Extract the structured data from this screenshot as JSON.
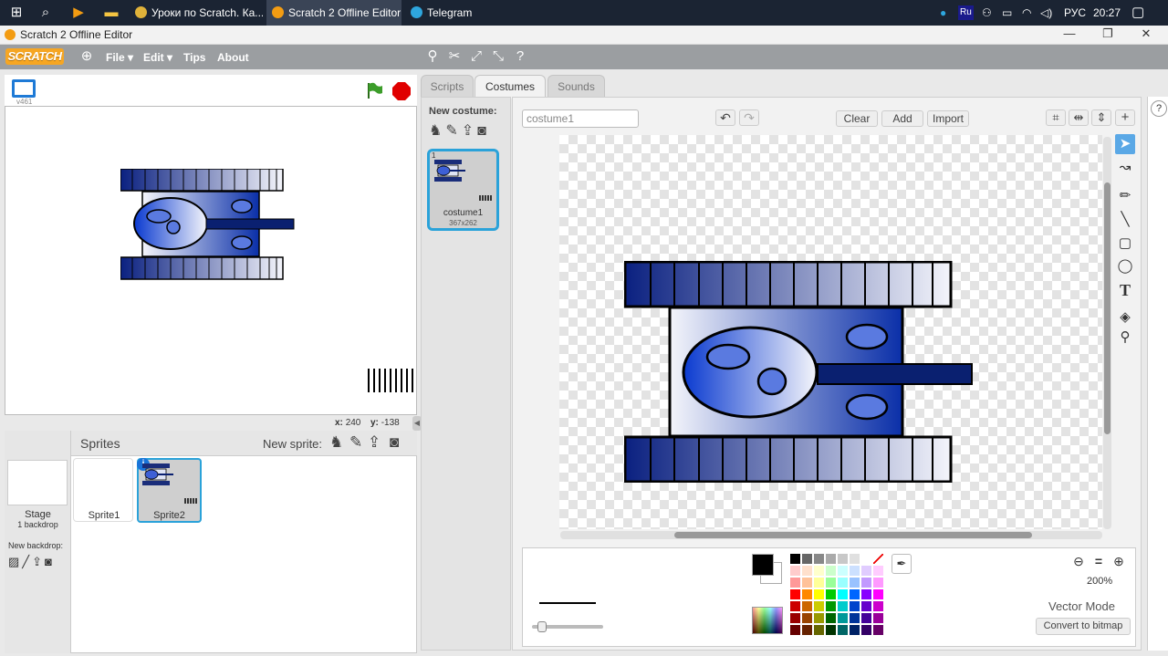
{
  "taskbar": {
    "apps": [
      {
        "label": "Уроки по Scratch. Ка..."
      },
      {
        "label": "Scratch 2 Offline Editor"
      },
      {
        "label": "Telegram"
      }
    ],
    "lang": "РУС",
    "time": "20:27"
  },
  "window": {
    "title": "Scratch 2 Offline Editor"
  },
  "menubar": {
    "logo": "SCRATCH",
    "items": [
      "File ▾",
      "Edit ▾",
      "Tips",
      "About"
    ]
  },
  "stage": {
    "version": "v461",
    "x_label": "x:",
    "x_value": "240",
    "y_label": "y:",
    "y_value": "-138"
  },
  "sprites": {
    "title": "Sprites",
    "new_sprite": "New sprite:",
    "stage_label": "Stage",
    "stage_sub": "1 backdrop",
    "new_backdrop": "New backdrop:",
    "items": [
      {
        "name": "Sprite1"
      },
      {
        "name": "Sprite2"
      }
    ]
  },
  "tabs": [
    "Scripts",
    "Costumes",
    "Sounds"
  ],
  "costumes": {
    "new_costume": "New costume:",
    "list": [
      {
        "index": "1",
        "name": "costume1",
        "size": "367x262"
      }
    ]
  },
  "editor": {
    "name_value": "costume1",
    "clear": "Clear",
    "add": "Add",
    "import": "Import",
    "zoom": "200%",
    "mode": "Vector Mode",
    "convert": "Convert to bitmap"
  },
  "colors": {
    "accent": "#2aa2d9",
    "tank_dark": "#0a2080",
    "tank_light": "#eef0f8"
  }
}
